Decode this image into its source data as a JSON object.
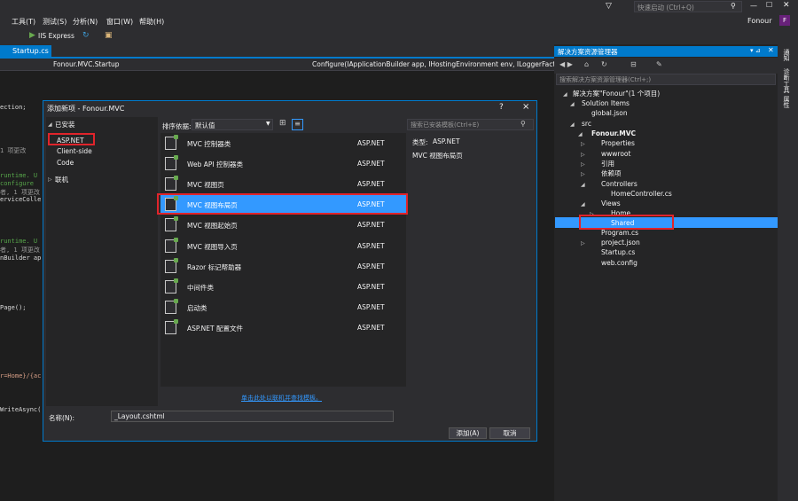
{
  "menu": [
    "工具(T)",
    "测试(S)",
    "分析(N)",
    "窗口(W)",
    "帮助(H)"
  ],
  "quick_launch": "快速启动 (Ctrl+Q)",
  "user": "Fonour",
  "user_initial": "F",
  "toolbar": {
    "run_label": "IIS Express"
  },
  "editor": {
    "tab": "Startup.cs",
    "nav_project": "Fonour.MVC.Startup",
    "nav_method": "Configure(IApplicationBuilder app, IHostingEnvironment env, ILoggerFactor",
    "lines": [
      "ection;",
      "1 项更改",
      "runtime. U",
      "configure",
      "者, 1 项更改",
      "erviceColle",
      "runtime. U",
      "者, 1 项更改",
      "nBuilder ap",
      "Page();",
      "r=Home}/{ac",
      "WriteAsync("
    ]
  },
  "solution_explorer": {
    "title": "解决方案资源管理器",
    "search_placeholder": "搜索解决方案资源管理器(Ctrl+;)",
    "items": [
      "解决方案\"Fonour\"(1 个项目)",
      "Solution Items",
      "global.json",
      "src",
      "Fonour.MVC",
      "Properties",
      "wwwroot",
      "引用",
      "依赖项",
      "Controllers",
      "HomeController.cs",
      "Views",
      "Home",
      "Shared",
      "Program.cs",
      "project.json",
      "Startup.cs",
      "web.config"
    ]
  },
  "side_tabs": [
    "通知",
    "诊断工具",
    "属性"
  ],
  "dialog": {
    "title": "添加新项 - Fonour.MVC",
    "help": "?",
    "close": "×",
    "installed": "已安装",
    "categories": [
      "ASP.NET",
      "Client-side",
      "Code"
    ],
    "online": "联机",
    "sort_label": "排序依据:",
    "sort_value": "默认值",
    "search_placeholder": "搜索已安装模板(Ctrl+E)",
    "templates": [
      {
        "name": "MVC 控制器类",
        "type": "ASP.NET"
      },
      {
        "name": "Web API 控制器类",
        "type": "ASP.NET"
      },
      {
        "name": "MVC 视图页",
        "type": "ASP.NET"
      },
      {
        "name": "MVC 视图布局页",
        "type": "ASP.NET"
      },
      {
        "name": "MVC 视图起始页",
        "type": "ASP.NET"
      },
      {
        "name": "MVC 视图导入页",
        "type": "ASP.NET"
      },
      {
        "name": "Razor 标记帮助器",
        "type": "ASP.NET"
      },
      {
        "name": "中间件类",
        "type": "ASP.NET"
      },
      {
        "name": "启动类",
        "type": "ASP.NET"
      },
      {
        "name": "ASP.NET 配置文件",
        "type": "ASP.NET"
      }
    ],
    "detail_type_label": "类型:",
    "detail_type_value": "ASP.NET",
    "detail_desc": "MVC 视图布局页",
    "online_link": "单击此处以联机并查找模板。",
    "name_label": "名称(N):",
    "name_value": "_Layout.cshtml",
    "add_button": "添加(A)",
    "cancel_button": "取消"
  }
}
